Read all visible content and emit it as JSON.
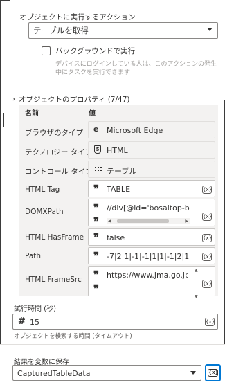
{
  "action": {
    "label": "オブジェクトに実行するアクション",
    "value": "テーブルを取得",
    "background_checkbox": {
      "label": "バックグラウンドで実行",
      "checked": false,
      "description": "デバイスにログインしている人は、このアクションの発生中にタスクを実行できます"
    }
  },
  "properties": {
    "header": "オブジェクトのプロパティ (7/47)",
    "col_name": "名前",
    "col_value": "値",
    "rows": [
      {
        "name": "ブラウザのタイプ",
        "value": "Microsoft Edge",
        "icon": "edge-icon",
        "readonly": true
      },
      {
        "name": "テクノロジー タイプ",
        "value": "HTML",
        "icon": "html5-icon",
        "readonly": true
      },
      {
        "name": "コントロール タイプ",
        "value": "テーブル",
        "icon": "grid-icon",
        "readonly": true
      },
      {
        "name": "HTML Tag",
        "value": "TABLE",
        "icon": "quote-icon",
        "readonly": false
      },
      {
        "name": "DOMXPath",
        "value": "//div[@id='bosaitop-bos",
        "icon": "quote-icon",
        "readonly": false
      },
      {
        "name": "HTML HasFrame",
        "value": "false",
        "icon": "quote-icon",
        "readonly": false
      },
      {
        "name": "Path",
        "value": "-7|2|1|-1|-1|1|1|-1|2|1",
        "icon": "quote-icon",
        "readonly": false
      },
      {
        "name": "HTML FrameSrc",
        "value": "https://www.jma.go.jp/b",
        "icon": "quote-icon",
        "readonly": false
      }
    ],
    "fx_label": "{x}"
  },
  "timeout": {
    "label": "試行時間 (秒)",
    "value": "15",
    "help": "オブジェクトを検索する時間 (タイムアウト)"
  },
  "output": {
    "label": "結果を変数に保存",
    "value": "CapturedTableData",
    "fx_label": "{x}"
  }
}
